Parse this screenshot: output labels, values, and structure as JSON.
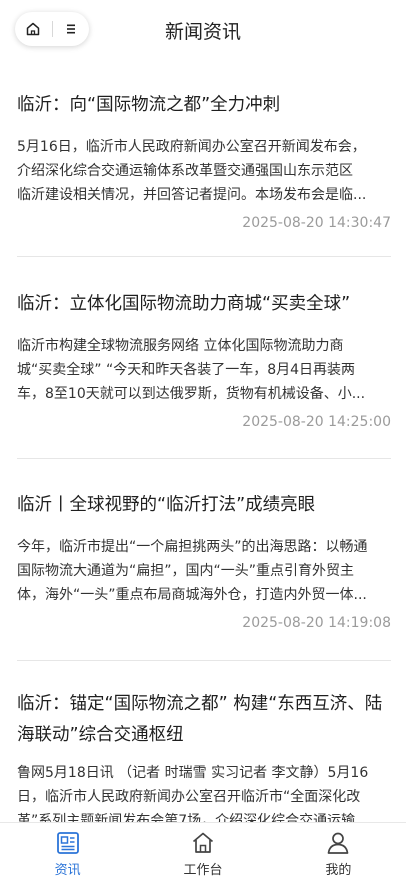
{
  "header": {
    "title": "新闻资讯",
    "home_icon": "home-icon",
    "menu_icon": "menu-icon"
  },
  "articles": [
    {
      "title": "临沂：向“国际物流之都”全力冲刺",
      "lines": [
        "5月16日，临沂市人民政府新闻办公室召开新闻发布会，",
        "介绍深化综合交通运输体系改革暨交通强国山东示范区",
        "临沂建设相关情况，并回答记者提问。本场发布会是临..."
      ],
      "time": "2025-08-20 14:30:47"
    },
    {
      "title": "临沂：立体化国际物流助力商城“买卖全球”",
      "lines": [
        "临沂市构建全球物流服务网络 立体化国际物流助力商",
        "城“买卖全球” “今天和昨天各装了一车，8月4日再装两",
        "车，8至10天就可以到达俄罗斯，货物有机械设备、小..."
      ],
      "time": "2025-08-20 14:25:00"
    },
    {
      "title": "临沂丨全球视野的“临沂打法”成绩亮眼",
      "lines": [
        "今年，临沂市提出“一个扁担挑两头”的出海思路：以畅通",
        "国际物流大通道为“扁担”，国内“一头”重点引育外贸主",
        "体，海外“一头”重点布局商城海外仓，打造内外贸一体..."
      ],
      "time": "2025-08-20 14:19:08"
    },
    {
      "title_lines": [
        "临沂：锚定“国际物流之都” 构建“东西互济、陆",
        "海联动”综合交通枢纽"
      ],
      "lines": [
        "鲁网5月18日讯 （记者 时瑞雪 实习记者 李文静）5月16",
        "日，临沂市人民政府新闻办公室召开临沂市“全面深化改",
        "革”系列主题新闻发布会第7场，介绍深化综合交通运输"
      ]
    }
  ],
  "tabs": [
    {
      "label": "资讯",
      "icon": "news-icon",
      "active": true
    },
    {
      "label": "工作台",
      "icon": "workbench-home-icon",
      "active": false
    },
    {
      "label": "我的",
      "icon": "user-icon",
      "active": false
    }
  ],
  "colors": {
    "accent": "#2b74d8",
    "text": "#222222",
    "muted": "#9b9b9b",
    "divider": "#e6e6e6"
  }
}
